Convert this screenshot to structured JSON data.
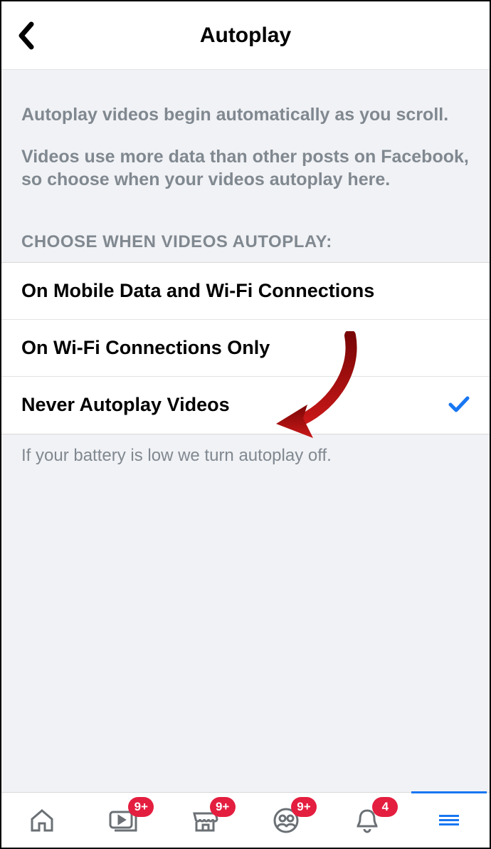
{
  "header": {
    "title": "Autoplay"
  },
  "description": {
    "line1": "Autoplay videos begin automatically as you scroll.",
    "line2": "Videos use more data than other posts on Facebook, so choose when your videos autoplay here."
  },
  "section_label": "CHOOSE WHEN VIDEOS AUTOPLAY:",
  "options": [
    {
      "label": "On Mobile Data and Wi-Fi Connections",
      "selected": false
    },
    {
      "label": "On Wi-Fi Connections Only",
      "selected": false
    },
    {
      "label": "Never Autoplay Videos",
      "selected": true
    }
  ],
  "footer_note": "If your battery is low we turn autoplay off.",
  "tabs": {
    "watch_badge": "9+",
    "marketplace_badge": "9+",
    "groups_badge": "9+",
    "notifications_badge": "4"
  },
  "colors": {
    "accent": "#1877f2",
    "badge": "#e41e3f",
    "annotation": "#aa0a0a"
  }
}
